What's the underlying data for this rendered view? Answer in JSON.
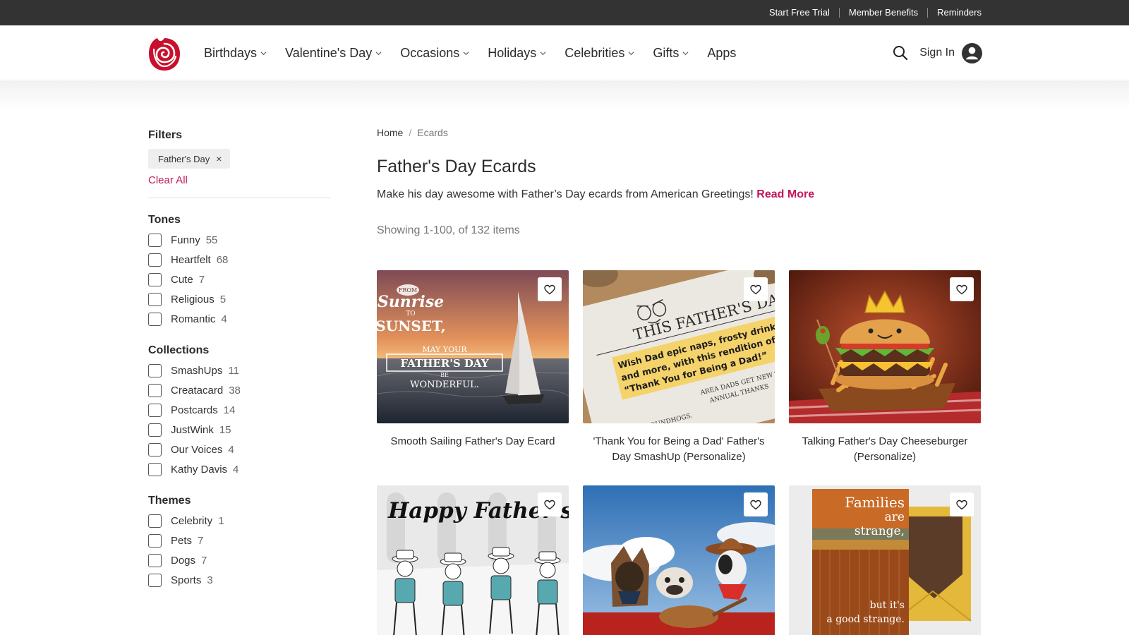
{
  "utility": {
    "links": [
      "Start Free Trial",
      "Member Benefits",
      "Reminders"
    ]
  },
  "header": {
    "nav": [
      "Birthdays",
      "Valentine's Day",
      "Occasions",
      "Holidays",
      "Celebrities",
      "Gifts",
      "Apps"
    ],
    "sign_in": "Sign In",
    "brand_color": "#c8102e"
  },
  "sidebar": {
    "filters_title": "Filters",
    "active_filter": "Father's Day",
    "remove_glyph": "×",
    "clear_all": "Clear All",
    "groups": [
      {
        "title": "Tones",
        "options": [
          {
            "label": "Funny",
            "count": "55"
          },
          {
            "label": "Heartfelt",
            "count": "68"
          },
          {
            "label": "Cute",
            "count": "7"
          },
          {
            "label": "Religious",
            "count": "5"
          },
          {
            "label": "Romantic",
            "count": "4"
          }
        ]
      },
      {
        "title": "Collections",
        "options": [
          {
            "label": "SmashUps",
            "count": "11"
          },
          {
            "label": "Creatacard",
            "count": "38"
          },
          {
            "label": "Postcards",
            "count": "14"
          },
          {
            "label": "JustWink",
            "count": "15"
          },
          {
            "label": "Our Voices",
            "count": "4"
          },
          {
            "label": "Kathy Davis",
            "count": "4"
          }
        ]
      },
      {
        "title": "Themes",
        "options": [
          {
            "label": "Celebrity",
            "count": "1"
          },
          {
            "label": "Pets",
            "count": "7"
          },
          {
            "label": "Dogs",
            "count": "7"
          },
          {
            "label": "Sports",
            "count": "3"
          }
        ]
      }
    ]
  },
  "content": {
    "breadcrumb": {
      "home": "Home",
      "separator": "/",
      "current": "Ecards"
    },
    "title": "Father's Day Ecards",
    "intro": "Make his day awesome with Father’s Day ecards from American Greetings!",
    "read_more": "Read More",
    "showing": "Showing 1-100, of 132 items",
    "accent_color": "#c2185b"
  },
  "cards": [
    {
      "title": "Smooth Sailing Father's Day Ecard",
      "image": "sailboat-sunset",
      "art": {
        "from": "FROM",
        "sunrise": "Sunrise",
        "to": "TO",
        "sunset": "SUNSET,",
        "may_your": "MAY YOUR",
        "fathers_day": "FATHER'S DAY",
        "be": "BE",
        "wonderful": "WONDERFUL."
      }
    },
    {
      "title": "'Thank You for Being a Dad' Father's Day SmashUp (Personalize)",
      "image": "newspaper",
      "art": {
        "headline": "THIS FATHER'S DAY",
        "line1": "Wish Dad epic naps, frosty drinks",
        "line2": "and more, with this rendition of",
        "line3": "“Thank You for Being a Dad!”",
        "side1": "AREA DADS GET NEW TIE",
        "side2": "ANNUAL THANKS",
        "bottom": "LIKE GROUNDHOGS."
      }
    },
    {
      "title": "Talking Father's Day Cheeseburger (Personalize)",
      "image": "cheeseburger-crown"
    },
    {
      "title": "",
      "image": "happy-fathers-day-cartoon",
      "art": {
        "script": "Happy Father's Day"
      }
    },
    {
      "title": "",
      "image": "cowboy-dogs"
    },
    {
      "title": "",
      "image": "families-card",
      "art": {
        "line1": "Families",
        "line2": "are",
        "line3": "strange,",
        "line4": "but it's",
        "line5": "a good strange."
      }
    }
  ]
}
